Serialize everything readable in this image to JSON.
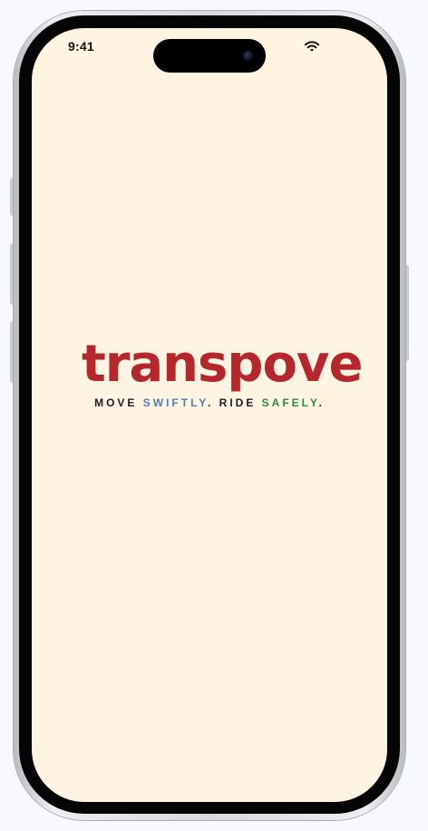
{
  "status_bar": {
    "time": "9:41",
    "wifi_icon": "wifi-icon"
  },
  "logo": {
    "text": "transpove",
    "color": "#b5272d"
  },
  "tagline": {
    "part1": "MOVE ",
    "part2": "SWIFTLY",
    "part3": ". RIDE ",
    "part4": "SAFELY",
    "part5": ".",
    "colors": {
      "dark": "#1b1b2b",
      "blue": "#4f7fb8",
      "green": "#2f8a3a"
    }
  },
  "screen": {
    "background": "#fff4e2"
  }
}
